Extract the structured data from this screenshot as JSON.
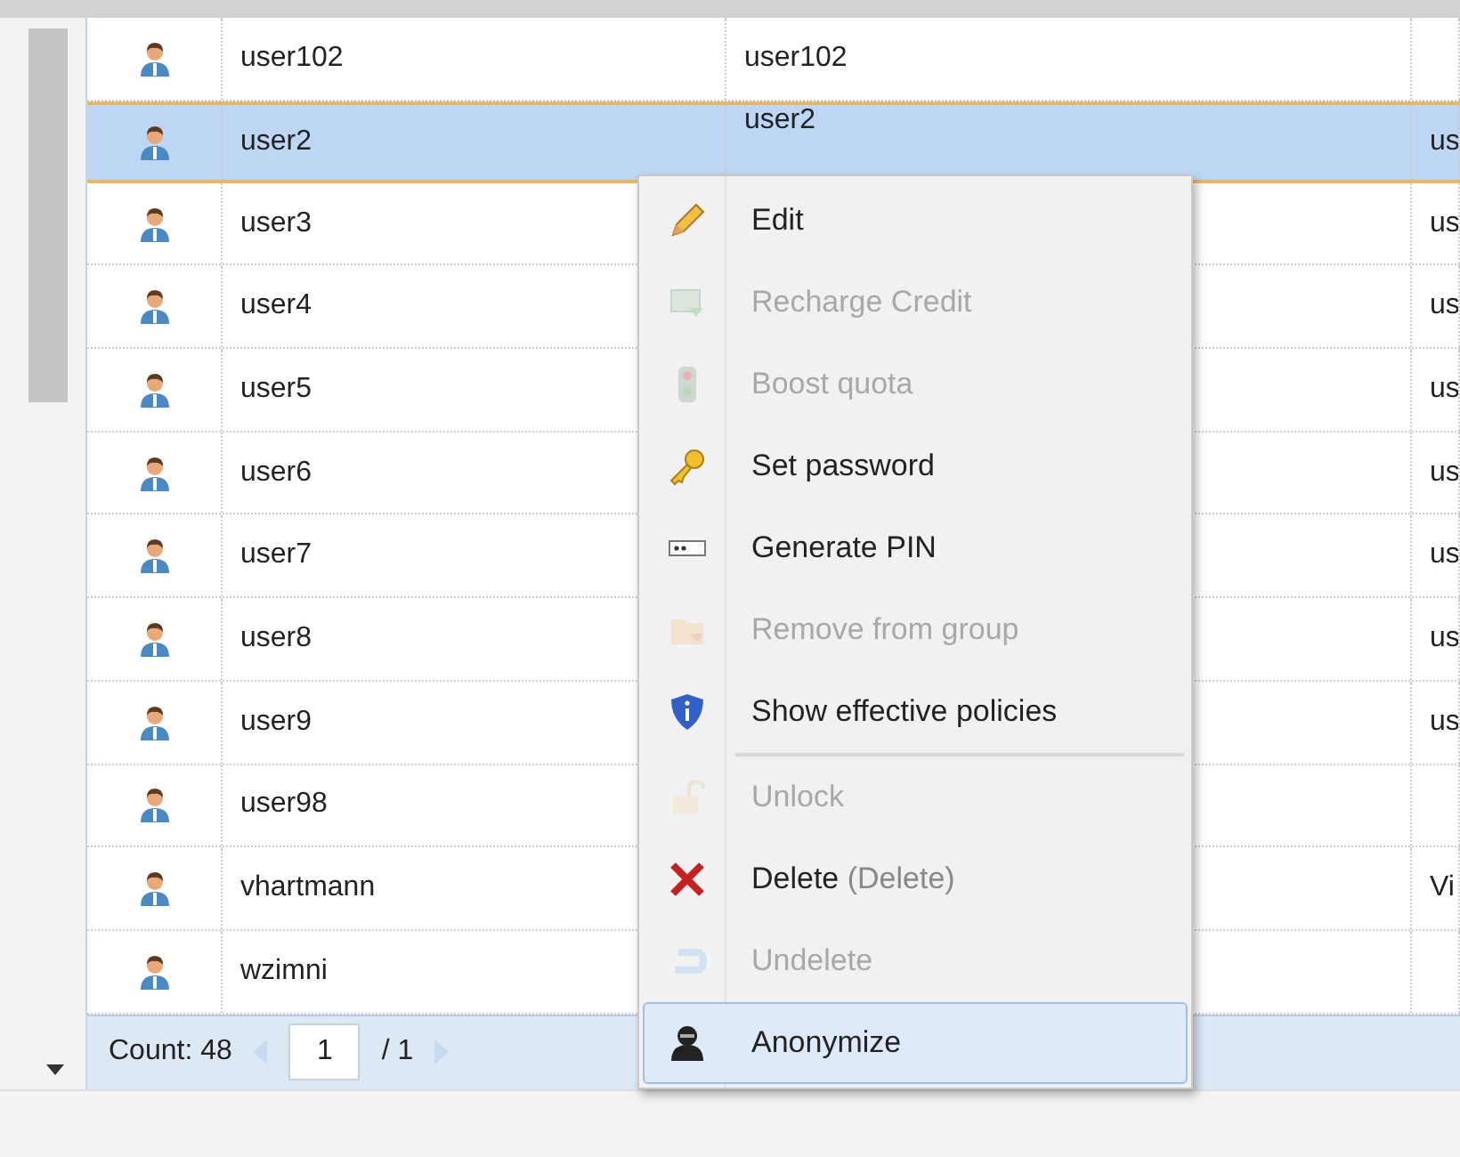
{
  "table": {
    "rows": [
      {
        "name": "user102",
        "column_3": "user102",
        "column_4": "",
        "selected": false
      },
      {
        "name": "user2",
        "column_3": "user2",
        "column_4": "us",
        "selected": true
      },
      {
        "name": "user3",
        "column_3": "",
        "column_4": "us",
        "selected": false
      },
      {
        "name": "user4",
        "column_3": "",
        "column_4": "us",
        "selected": false
      },
      {
        "name": "user5",
        "column_3": "",
        "column_4": "us",
        "selected": false
      },
      {
        "name": "user6",
        "column_3": "",
        "column_4": "us",
        "selected": false
      },
      {
        "name": "user7",
        "column_3": "",
        "column_4": "us",
        "selected": false
      },
      {
        "name": "user8",
        "column_3": "",
        "column_4": "us",
        "selected": false
      },
      {
        "name": "user9",
        "column_3": "",
        "column_4": "us",
        "selected": false
      },
      {
        "name": "user98",
        "column_3": "",
        "column_4": "",
        "selected": false
      },
      {
        "name": "vhartmann",
        "column_3": "",
        "column_4": "Vi",
        "selected": false
      },
      {
        "name": "wzimni",
        "column_3": "",
        "column_4": "",
        "selected": false
      }
    ]
  },
  "footer": {
    "count": "Count: 48",
    "page": "1",
    "pages": "/ 1"
  },
  "context_menu": {
    "items": [
      {
        "kind": "edit",
        "label": "Edit",
        "disabled": false,
        "selected": false
      },
      {
        "kind": "credit",
        "label": "Recharge Credit",
        "disabled": true,
        "selected": false
      },
      {
        "kind": "quota",
        "label": "Boost quota",
        "disabled": true,
        "selected": false
      },
      {
        "kind": "key",
        "label": "Set password",
        "disabled": false,
        "selected": false
      },
      {
        "kind": "pin",
        "label": "Generate PIN",
        "disabled": false,
        "selected": false
      },
      {
        "kind": "group",
        "label": "Remove from group",
        "disabled": true,
        "selected": false
      },
      {
        "kind": "shield",
        "label": "Show effective policies",
        "disabled": false,
        "selected": false
      },
      {
        "kind": "unlock",
        "label": "Unlock",
        "disabled": true,
        "selected": false,
        "separator_before": true
      },
      {
        "kind": "delete",
        "label": "Delete",
        "shortcut": "(Delete)",
        "disabled": false,
        "selected": false
      },
      {
        "kind": "undelete",
        "label": "Undelete",
        "disabled": true,
        "selected": false
      },
      {
        "kind": "anon",
        "label": "Anonymize",
        "disabled": false,
        "selected": true
      }
    ]
  }
}
